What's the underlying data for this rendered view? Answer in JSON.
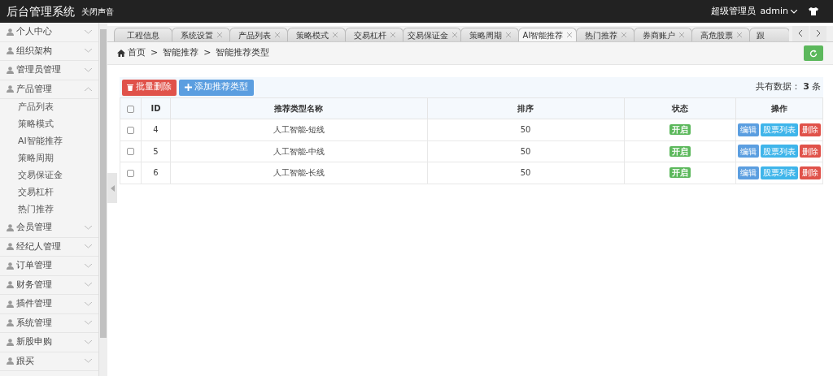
{
  "header": {
    "title": "后台管理系统",
    "sound_toggle": "关闭声音",
    "role": "超级管理员",
    "user": "admin"
  },
  "sidebar": {
    "items": [
      {
        "label": "个人中心",
        "expanded": false
      },
      {
        "label": "组织架构",
        "expanded": false
      },
      {
        "label": "管理员管理",
        "expanded": false
      },
      {
        "label": "产品管理",
        "expanded": true,
        "children": [
          {
            "label": "产品列表"
          },
          {
            "label": "策略模式"
          },
          {
            "label": "AI智能推荐"
          },
          {
            "label": "策略周期"
          },
          {
            "label": "交易保证金"
          },
          {
            "label": "交易杠杆"
          },
          {
            "label": "热门推荐"
          }
        ]
      },
      {
        "label": "会员管理",
        "expanded": false
      },
      {
        "label": "经纪人管理",
        "expanded": false
      },
      {
        "label": "订单管理",
        "expanded": false
      },
      {
        "label": "财务管理",
        "expanded": false
      },
      {
        "label": "插件管理",
        "expanded": false
      },
      {
        "label": "系统管理",
        "expanded": false
      },
      {
        "label": "新股申购",
        "expanded": false
      },
      {
        "label": "跟买",
        "expanded": false
      }
    ]
  },
  "tabs": [
    {
      "label": "工程信息",
      "selected": false,
      "closable": false
    },
    {
      "label": "系统设置",
      "selected": false,
      "closable": true
    },
    {
      "label": "产品列表",
      "selected": false,
      "closable": true
    },
    {
      "label": "策略模式",
      "selected": false,
      "closable": true
    },
    {
      "label": "交易杠杆",
      "selected": false,
      "closable": true
    },
    {
      "label": "交易保证金",
      "selected": false,
      "closable": true
    },
    {
      "label": "策略周期",
      "selected": false,
      "closable": true
    },
    {
      "label": "AI智能推荐",
      "selected": true,
      "closable": true
    },
    {
      "label": "热门推荐",
      "selected": false,
      "closable": true
    },
    {
      "label": "券商账户",
      "selected": false,
      "closable": true
    },
    {
      "label": "高危股票",
      "selected": false,
      "closable": true
    },
    {
      "label": "跟",
      "selected": false,
      "closable": false
    }
  ],
  "breadcrumb": [
    "首页",
    "智能推荐",
    "智能推荐类型"
  ],
  "breadcrumb_separator": ">",
  "toolbar": {
    "batch_delete": "批量删除",
    "add": "添加推荐类型",
    "total_label": "共有数据：",
    "total": "3",
    "total_unit": "条"
  },
  "table": {
    "select_all_checked": false,
    "columns": [
      "ID",
      "推荐类型名称",
      "排序",
      "状态",
      "操作"
    ],
    "rows": [
      {
        "checked": false,
        "id": "4",
        "name": "人工智能-短线",
        "sort": "50",
        "status": "开启",
        "actions": [
          "编辑",
          "股票列表",
          "删除"
        ]
      },
      {
        "checked": false,
        "id": "5",
        "name": "人工智能-中线",
        "sort": "50",
        "status": "开启",
        "actions": [
          "编辑",
          "股票列表",
          "删除"
        ]
      },
      {
        "checked": false,
        "id": "6",
        "name": "人工智能-长线",
        "sort": "50",
        "status": "开启",
        "actions": [
          "编辑",
          "股票列表",
          "删除"
        ]
      }
    ]
  }
}
